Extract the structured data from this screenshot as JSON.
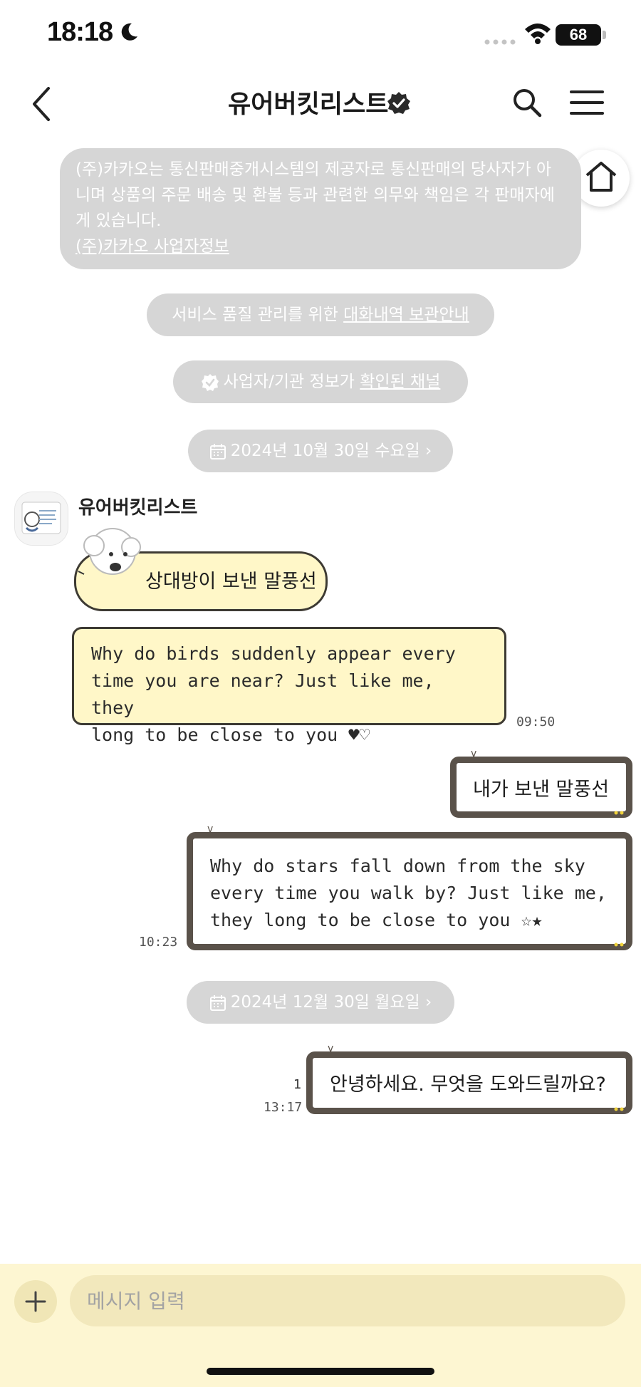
{
  "status_bar": {
    "time": "18:18",
    "battery": "68"
  },
  "header": {
    "title": "유어버킷리스트"
  },
  "notices": {
    "disclaimer": "(주)카카오는 통신판매중개시스템의 제공자로 통신판매의 당사자가 아니며 상품의 주문 배송 및 환불 등과 관련한 의무와 책임은 각 판매자에게 있습니다.",
    "business_info_link": "(주)카카오 사업자정보",
    "service_prefix": "서비스 품질 관리를 위한 ",
    "service_link": "대화내역 보관안내",
    "verified_prefix": "사업자/기관 정보가 ",
    "verified_link": "확인된 채널"
  },
  "dates": {
    "date1": "2024년 10월 30일 수요일",
    "date2": "2024년 12월 30일 월요일",
    "chevron": "›"
  },
  "incoming": {
    "sender": "유어버킷리스트",
    "bubble1": "상대방이 보낸 말풍선",
    "bubble2_lines": [
      "Why do birds suddenly appear every",
      "time you are near? Just like me, they",
      "long to be close to you ♥♡"
    ],
    "time": "09:50"
  },
  "outgoing": {
    "bubble1": "내가 보낸 말풍선",
    "bubble2_lines": [
      "Why do stars fall down from the sky",
      "every time you walk by? Just like me,",
      "they long to be close to you ☆★"
    ],
    "time2": "10:23",
    "bubble3": "안녕하세요. 무엇을 도와드릴까요?",
    "unread": "1",
    "time3": "13:17"
  },
  "input": {
    "placeholder": "메시지 입력"
  },
  "colors": {
    "notice_gray": "#d6d6d6",
    "incoming_bubble": "#fff7c8",
    "outgoing_border": "#5a524a",
    "input_bar": "#fdf6d2"
  }
}
